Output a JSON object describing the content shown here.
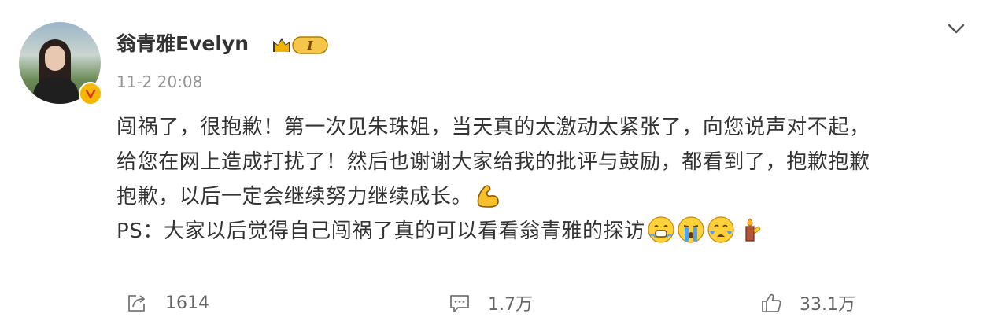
{
  "post": {
    "author": "翁青雅Evelyn",
    "level_badge_text": "I",
    "timestamp": "11-2 20:08",
    "content_lines": [
      "闯祸了，很抱歉！第一次见朱珠姐，当天真的太激动太紧张了，向您说声对不起，",
      "给您在网上造成打扰了！然后也谢谢大家给我的批评与鼓励，都看到了，抱歉抱歉",
      "抱歉，以后一定会继续努力继续成长。",
      "PS：大家以后觉得自己闯祸了真的可以看看翁青雅的探访"
    ],
    "emojis": [
      "flexed-biceps-emoji",
      "awkward-smile-emoji",
      "crying-emoji",
      "crying-emoji",
      "thumbs-up-candle-emoji"
    ]
  },
  "actions": {
    "share_count": "1614",
    "comment_count": "1.7万",
    "like_count": "33.1万"
  },
  "colors": {
    "text": "#333333",
    "muted": "#939393",
    "action_text": "#666666",
    "verified_badge": "#f5b800",
    "level_badge": "#f0b400"
  }
}
